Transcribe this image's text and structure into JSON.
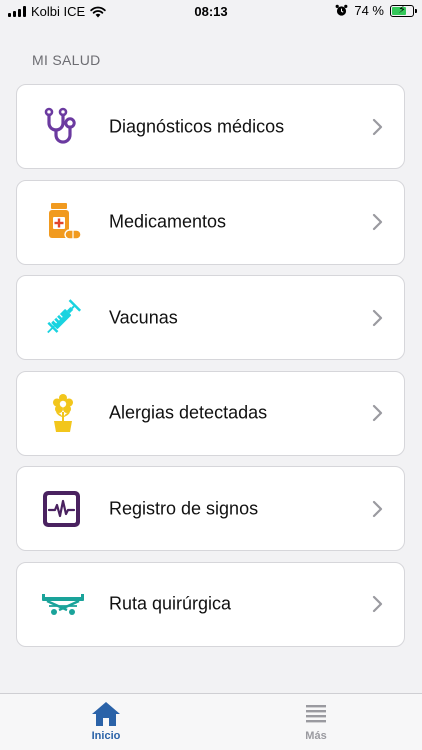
{
  "status_bar": {
    "carrier": "Kolbi ICE",
    "time": "08:13",
    "battery_percent": "74 %",
    "battery_level": 0.74
  },
  "section": {
    "title": "MI SALUD"
  },
  "menu": {
    "items": [
      {
        "label": "Diagnósticos médicos",
        "icon": "stethoscope-icon",
        "color": "#6b3aa0"
      },
      {
        "label": "Medicamentos",
        "icon": "medicine-bottle-icon",
        "color": "#f19a1f"
      },
      {
        "label": "Vacunas",
        "icon": "syringe-icon",
        "color": "#19d3e0"
      },
      {
        "label": "Alergias detectadas",
        "icon": "flower-icon",
        "color": "#f2c61c"
      },
      {
        "label": "Registro de signos",
        "icon": "vital-signs-monitor-icon",
        "color": "#4a2260"
      },
      {
        "label": "Ruta quirúrgica",
        "icon": "stretcher-icon",
        "color": "#1aa39a"
      }
    ]
  },
  "tab_bar": {
    "home_label": "Inicio",
    "more_label": "Más",
    "active_color": "#2a62a8",
    "inactive_color": "#9a9aa0"
  }
}
